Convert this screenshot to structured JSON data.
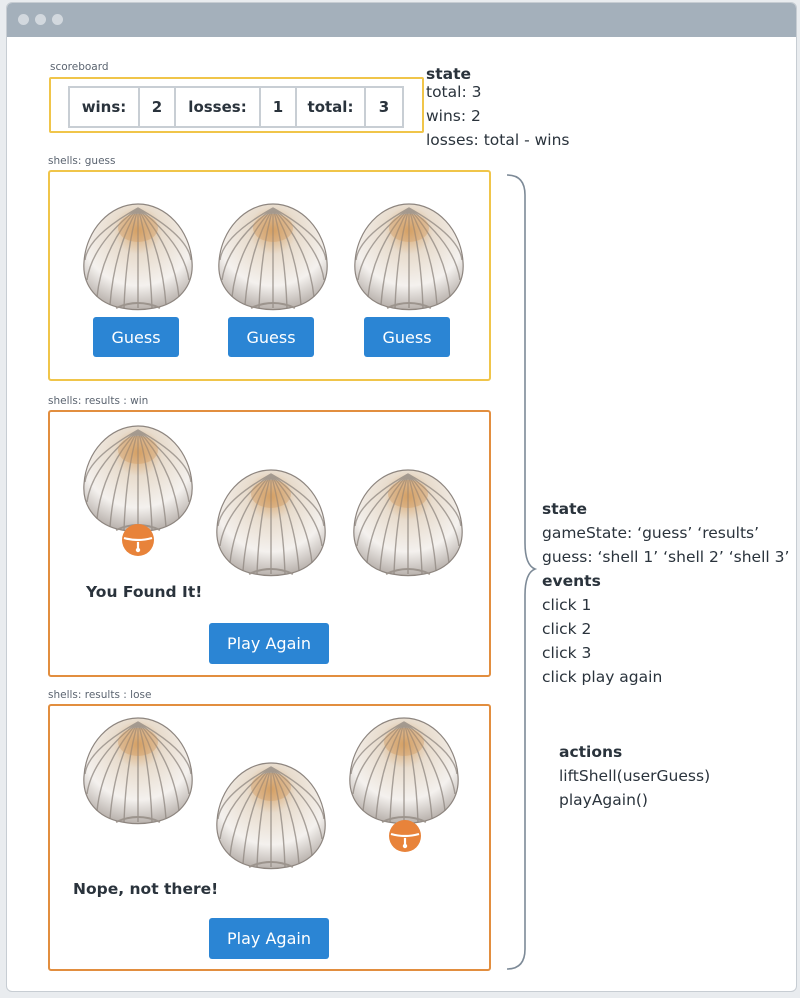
{
  "window": {
    "title": ""
  },
  "scoreboard": {
    "caption": "scoreboard",
    "wins_label": "wins:",
    "wins_value": "2",
    "losses_label": "losses:",
    "losses_value": "1",
    "total_label": "total:",
    "total_value": "3"
  },
  "state_note": {
    "heading": "state",
    "lines": [
      "total: 3",
      "wins: 2",
      "losses: total - wins"
    ]
  },
  "panel_guess": {
    "caption": "shells: guess",
    "buttons": [
      "Guess",
      "Guess",
      "Guess"
    ]
  },
  "panel_win": {
    "caption": "shells: results : win",
    "message": "You Found It!",
    "button": "Play Again"
  },
  "panel_lose": {
    "caption": "shells: results : lose",
    "message": "Nope, not there!",
    "button": "Play Again"
  },
  "shells_note": {
    "state_heading": "state",
    "state_lines": [
      "gameState: ‘guess’ ‘results’",
      "guess: ‘shell 1’ ‘shell 2’ ‘shell 3’"
    ],
    "events_heading": "events",
    "events_lines": [
      "click 1",
      "click 2",
      "click 3",
      "click play again"
    ],
    "actions_heading": "actions",
    "actions_lines": [
      "liftShell(userGuess)",
      "playAgain()"
    ]
  },
  "colors": {
    "scoreboard_border": "#f0c54a",
    "guess_border": "#f0c54a",
    "result_border": "#e28e3f",
    "button": "#2b85d4",
    "pearl": "#e8833a",
    "titlebar": "#a4b0bb"
  },
  "icons": {
    "shell": "seashell-icon",
    "pearl": "pearl-icon"
  }
}
